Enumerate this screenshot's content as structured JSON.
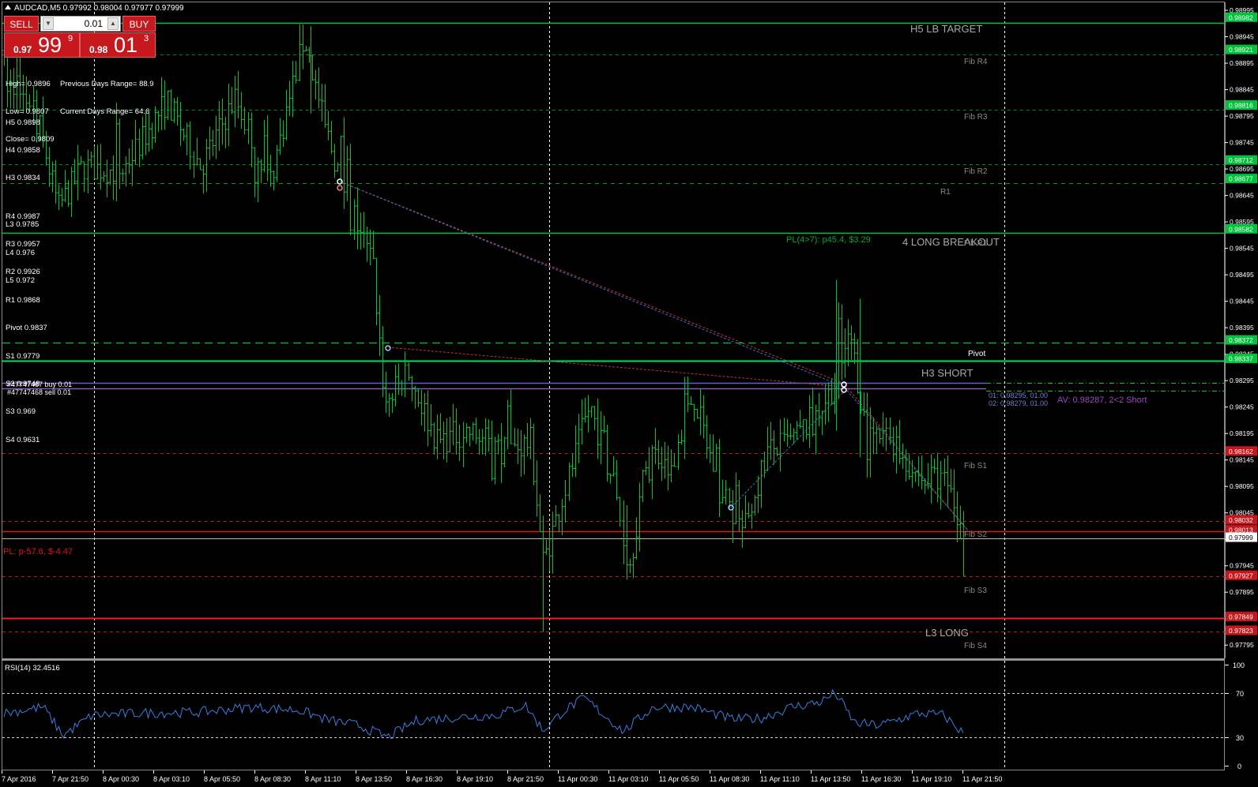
{
  "window": {
    "title": "AUDCAD,M5  0.97992 0.98004 0.97977 0.97999"
  },
  "trade_panel": {
    "sell_label": "SELL",
    "buy_label": "BUY",
    "lot_value": "0.01",
    "sell_price": {
      "small": "0.97",
      "big": "99",
      "sup": "9"
    },
    "buy_price": {
      "small": "0.98",
      "big": "01",
      "sup": "3"
    }
  },
  "info": {
    "high": "High= 0.9896",
    "low": "Low= 0.9807",
    "close": "Close= 0.9809",
    "prev_range": "Previous Days Range= 88.9",
    "curr_range": "Current Days Range= 64.6",
    "camarilla": [
      "H5 0.9898",
      "H4 0.9858",
      "H3 0.9834",
      "",
      "L3 0.9785",
      "L4 0.976",
      "L5 0.972"
    ],
    "pivots": [
      "R4 0.9987",
      "R3 0.9957",
      "R2 0.9926",
      "R1 0.9868",
      "Pivot 0.9837",
      "S1 0.9779",
      "S2 0.9748",
      "S3 0.969",
      "S4 0.9631"
    ]
  },
  "orders": [
    "#47747467 buy 0.01",
    "#47747468 sell 0.01"
  ],
  "pl_left": "PL: p-57.6, $-4.47",
  "pl_mid": "PL(4>7): p45.4, $3.29",
  "basket_info": {
    "line1": "01: 0.98295, 01.00",
    "line2": "02: 0.98279, 01.00",
    "avg": "AV: 0.98287, 2<2 Short"
  },
  "level_labels": {
    "h5": "H5 LB TARGET",
    "fib_r4": "Fib R4",
    "fib_r3": "Fib R3",
    "fib_r2": "Fib R2",
    "r1": "R1",
    "h4": "4 LONG BREAKOUT",
    "fib_r1": "Fib R1",
    "pivot": "Pivot",
    "h3": "H3 SHORT",
    "fib_s1": "Fib S1",
    "fib_s2": "Fib S2",
    "fib_s3": "Fib S3",
    "l3": "L3 LONG",
    "fib_s4": "Fib S4"
  },
  "price_axis": {
    "ticks": [
      "0.98995",
      "0.98945",
      "0.98895",
      "0.98845",
      "0.98795",
      "0.98745",
      "0.98695",
      "0.98645",
      "0.98595",
      "0.98545",
      "0.98495",
      "0.98445",
      "0.98395",
      "0.98345",
      "0.98295",
      "0.98245",
      "0.98195",
      "0.98145",
      "0.98095",
      "0.98045",
      "0.97995",
      "0.97945",
      "0.97895",
      "0.97845",
      "0.97795"
    ],
    "markers": [
      {
        "label": "0.98982",
        "value": 0.98982,
        "color": "#00c23b"
      },
      {
        "label": "0.98921",
        "value": 0.98921,
        "color": "#00c23b"
      },
      {
        "label": "0.98816",
        "value": 0.98816,
        "color": "#00c23b"
      },
      {
        "label": "0.98712",
        "value": 0.98712,
        "color": "#00c23b"
      },
      {
        "label": "0.98677",
        "value": 0.98677,
        "color": "#00c23b"
      },
      {
        "label": "0.98582",
        "value": 0.98582,
        "color": "#00c23b"
      },
      {
        "label": "0.98372",
        "value": 0.98372,
        "color": "#00c23b"
      },
      {
        "label": "0.98337",
        "value": 0.98337,
        "color": "#00c23b"
      },
      {
        "label": "0.98162",
        "value": 0.98162,
        "color": "#c8161d"
      },
      {
        "label": "0.98032",
        "value": 0.98032,
        "color": "#c8161d"
      },
      {
        "label": "0.98013",
        "value": 0.98013,
        "color": "#c8161d"
      },
      {
        "label": "0.97999",
        "value": 0.97999,
        "color": "#ffffff"
      },
      {
        "label": "0.97927",
        "value": 0.97927,
        "color": "#c8161d"
      },
      {
        "label": "0.97849",
        "value": 0.97849,
        "color": "#c8161d"
      },
      {
        "label": "0.97823",
        "value": 0.97823,
        "color": "#c8161d"
      }
    ]
  },
  "time_axis": [
    "7 Apr 2016",
    "7 Apr 21:50",
    "8 Apr 00:30",
    "8 Apr 03:10",
    "8 Apr 05:50",
    "8 Apr 08:30",
    "8 Apr 11:10",
    "8 Apr 13:50",
    "8 Apr 16:30",
    "8 Apr 19:10",
    "8 Apr 21:50",
    "11 Apr 00:30",
    "11 Apr 03:10",
    "11 Apr 05:50",
    "11 Apr 08:30",
    "11 Apr 11:10",
    "11 Apr 13:50",
    "11 Apr 16:30",
    "11 Apr 19:10",
    "11 Apr 21:50"
  ],
  "rsi": {
    "title": "RSI(14) 32.4516",
    "ticks": [
      "100",
      "70",
      "30",
      "0"
    ],
    "current": 32.4516
  },
  "chart_data": {
    "type": "ohlc",
    "symbol": "AUDCAD",
    "timeframe": "M5",
    "last": {
      "open": 0.97992,
      "high": 0.98004,
      "low": 0.97977,
      "close": 0.97999
    },
    "ylim": [
      0.9777,
      0.9901
    ],
    "path_anchors": [
      {
        "x": 0,
        "y": 0.98855
      },
      {
        "x": 0.03,
        "y": 0.9882
      },
      {
        "x": 0.055,
        "y": 0.9862
      },
      {
        "x": 0.08,
        "y": 0.987
      },
      {
        "x": 0.12,
        "y": 0.9869
      },
      {
        "x": 0.165,
        "y": 0.98825
      },
      {
        "x": 0.2,
        "y": 0.987
      },
      {
        "x": 0.235,
        "y": 0.9883
      },
      {
        "x": 0.27,
        "y": 0.9867
      },
      {
        "x": 0.305,
        "y": 0.98945
      },
      {
        "x": 0.325,
        "y": 0.9878
      },
      {
        "x": 0.345,
        "y": 0.9866
      },
      {
        "x": 0.375,
        "y": 0.9851
      },
      {
        "x": 0.387,
        "y": 0.9825
      },
      {
        "x": 0.41,
        "y": 0.9831
      },
      {
        "x": 0.44,
        "y": 0.9818
      },
      {
        "x": 0.47,
        "y": 0.982
      },
      {
        "x": 0.51,
        "y": 0.9816
      },
      {
        "x": 0.535,
        "y": 0.9818
      },
      {
        "x": 0.548,
        "y": 0.9795
      },
      {
        "x": 0.575,
        "y": 0.9812
      },
      {
        "x": 0.595,
        "y": 0.9825
      },
      {
        "x": 0.62,
        "y": 0.981
      },
      {
        "x": 0.635,
        "y": 0.9794
      },
      {
        "x": 0.655,
        "y": 0.9817
      },
      {
        "x": 0.675,
        "y": 0.9812
      },
      {
        "x": 0.7,
        "y": 0.9827
      },
      {
        "x": 0.727,
        "y": 0.9809
      },
      {
        "x": 0.752,
        "y": 0.9801
      },
      {
        "x": 0.775,
        "y": 0.9816
      },
      {
        "x": 0.8,
        "y": 0.9818
      },
      {
        "x": 0.825,
        "y": 0.9823
      },
      {
        "x": 0.845,
        "y": 0.9829
      },
      {
        "x": 0.86,
        "y": 0.9838
      },
      {
        "x": 0.878,
        "y": 0.9818
      },
      {
        "x": 0.9,
        "y": 0.9819
      },
      {
        "x": 0.925,
        "y": 0.9812
      },
      {
        "x": 0.96,
        "y": 0.981
      },
      {
        "x": 0.975,
        "y": 0.9799
      }
    ],
    "rsi_anchors": [
      {
        "x": 0,
        "y": 52
      },
      {
        "x": 0.04,
        "y": 58
      },
      {
        "x": 0.06,
        "y": 30
      },
      {
        "x": 0.09,
        "y": 50
      },
      {
        "x": 0.14,
        "y": 52
      },
      {
        "x": 0.2,
        "y": 53
      },
      {
        "x": 0.25,
        "y": 58
      },
      {
        "x": 0.3,
        "y": 55
      },
      {
        "x": 0.33,
        "y": 45
      },
      {
        "x": 0.36,
        "y": 40
      },
      {
        "x": 0.39,
        "y": 28
      },
      {
        "x": 0.42,
        "y": 45
      },
      {
        "x": 0.46,
        "y": 48
      },
      {
        "x": 0.5,
        "y": 50
      },
      {
        "x": 0.53,
        "y": 60
      },
      {
        "x": 0.548,
        "y": 35
      },
      {
        "x": 0.57,
        "y": 55
      },
      {
        "x": 0.59,
        "y": 67
      },
      {
        "x": 0.61,
        "y": 50
      },
      {
        "x": 0.63,
        "y": 34
      },
      {
        "x": 0.66,
        "y": 58
      },
      {
        "x": 0.7,
        "y": 58
      },
      {
        "x": 0.74,
        "y": 46
      },
      {
        "x": 0.77,
        "y": 47
      },
      {
        "x": 0.8,
        "y": 58
      },
      {
        "x": 0.83,
        "y": 63
      },
      {
        "x": 0.845,
        "y": 72
      },
      {
        "x": 0.865,
        "y": 42
      },
      {
        "x": 0.89,
        "y": 40
      },
      {
        "x": 0.93,
        "y": 52
      },
      {
        "x": 0.955,
        "y": 50
      },
      {
        "x": 0.975,
        "y": 32
      }
    ]
  }
}
